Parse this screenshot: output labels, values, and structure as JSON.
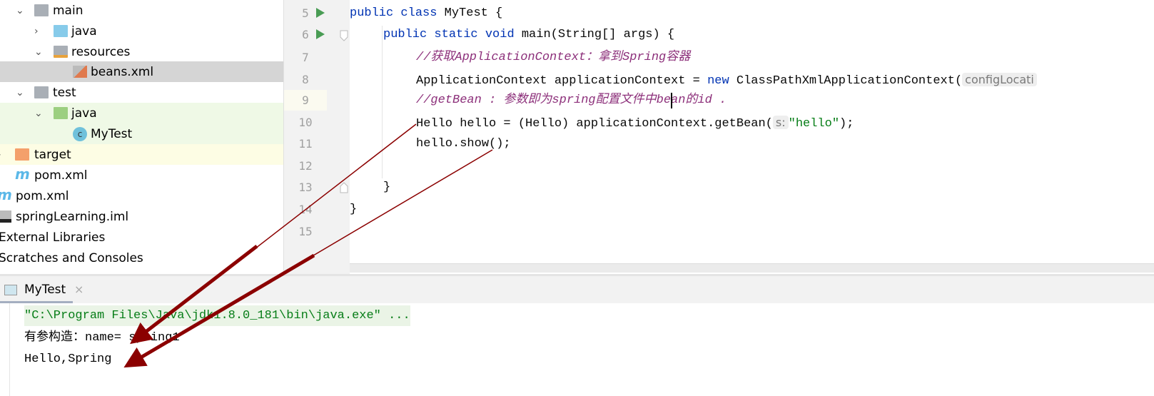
{
  "project_tree": {
    "items": [
      {
        "label": "main",
        "icon": "folder-icon",
        "expanded": true
      },
      {
        "label": "java",
        "icon": "source-folder-icon",
        "expanded": false
      },
      {
        "label": "resources",
        "icon": "resources-folder-icon",
        "expanded": true
      },
      {
        "label": "beans.xml",
        "icon": "spring-xml-file-icon",
        "selected": true
      },
      {
        "label": "test",
        "icon": "folder-icon",
        "expanded": true
      },
      {
        "label": "java",
        "icon": "test-folder-icon",
        "expanded": true
      },
      {
        "label": "MyTest",
        "icon": "java-class-run-icon"
      },
      {
        "label": "target",
        "icon": "excluded-folder-icon",
        "expanded": false
      },
      {
        "label": "pom.xml",
        "icon": "maven-icon"
      },
      {
        "label": "pom.xml",
        "icon": "maven-icon"
      },
      {
        "label": "springLearning.iml",
        "icon": "iml-file-icon"
      },
      {
        "label": "External Libraries",
        "icon": ""
      },
      {
        "label": "Scratches and Consoles",
        "icon": ""
      }
    ]
  },
  "editor": {
    "line_numbers": [
      "5",
      "6",
      "7",
      "8",
      "9",
      "10",
      "11",
      "12",
      "13",
      "14",
      "15"
    ],
    "lines": {
      "l5": {
        "kw1": "public",
        "kw2": "class",
        "rest": " MyTest {"
      },
      "l6": {
        "kw1": "public",
        "kw2": "static",
        "kw3": "void",
        "rest": " main(String[] args) {"
      },
      "l7": {
        "comment": "//获取ApplicationContext：拿到Spring容器"
      },
      "l8": {
        "pre": "ApplicationContext applicationContext = ",
        "kw": "new",
        "post": " ClassPathXmlApplicationContext(",
        "hint": "configLocati"
      },
      "l9": {
        "comment": "//getBean : 参数即为spring配置文件中bean的id ."
      },
      "l10": {
        "pre": "Hello hello = (Hello) applicationContext.getBean(",
        "hint": "s:",
        "str": "\"hello\"",
        "post": ");"
      },
      "l11": {
        "code": "hello.show();"
      },
      "l13": {
        "code": "}"
      },
      "l14": {
        "code": "}"
      }
    }
  },
  "run_panel": {
    "tab_label": "MyTest",
    "output": [
      "\"C:\\Program Files\\Java\\jdk1.8.0_181\\bin\\java.exe\" ...",
      "有参构造：name= spring1",
      "Hello,Spring"
    ]
  },
  "colors": {
    "keyword": "#0033b3",
    "comment": "#8c2f7a",
    "string": "#067d17",
    "arrow": "#8b0000",
    "selection": "#d5d5d5",
    "test_bg": "#eff9e6",
    "excluded_bg": "#fdfde4"
  }
}
